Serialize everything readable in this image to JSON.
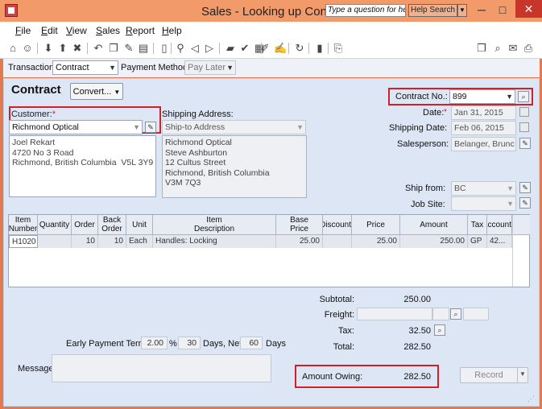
{
  "window": {
    "title": "Sales - Looking up Contract",
    "question_placeholder": "Type a question for help",
    "help_search": "Help Search",
    "min_glyph": "─",
    "max_glyph": "□",
    "close_glyph": "✕"
  },
  "menu": [
    "File",
    "Edit",
    "View",
    "Sales",
    "Report",
    "Help"
  ],
  "menu_underline": [
    "F",
    "E",
    "V",
    "S",
    "R",
    "H"
  ],
  "transaction": {
    "label": "Transaction:",
    "value": "Contract",
    "payment_label": "Payment Method:",
    "payment_value": "Pay Later"
  },
  "form": {
    "heading": "Contract",
    "convert_button": "Convert...",
    "customer_label": "Customer:",
    "required_mark": "*",
    "customer_value": "Richmond Optical",
    "customer_address": "Joel Rekart\n4720 No 3 Road\nRichmond, British Columbia  V5L 3Y9",
    "shipping_label": "Shipping Address:",
    "shipping_value": "Ship-to Address",
    "shipping_address": "Richmond Optical\nSteve Ashburton\n12 Cultus Street\nRichmond, British Columbia\nV3M 7Q3",
    "contract_no_label": "Contract No.:",
    "contract_no_value": "899",
    "date_label": "Date:",
    "date_value": "Jan 31, 2015",
    "shipping_date_label": "Shipping Date:",
    "shipping_date_value": "Feb 06, 2015",
    "salesperson_label": "Salesperson:",
    "salesperson_value": "Belanger, Brunc",
    "ship_from_label": "Ship from:",
    "ship_from_value": "BC",
    "job_site_label": "Job Site:",
    "job_site_value": ""
  },
  "grid": {
    "headers": [
      "Item\nNumber",
      "Quantity",
      "Order",
      "Back\nOrder",
      "Unit",
      "Item\nDescription",
      "Base\nPrice",
      "Discount",
      "Price",
      "Amount",
      "Tax",
      "Account"
    ],
    "rows": [
      [
        "H1020",
        "",
        "10",
        "10",
        "Each",
        "Handles: Locking",
        "25.00",
        "",
        "25.00",
        "250.00",
        "GP",
        "42..."
      ]
    ]
  },
  "totals": {
    "subtotal_label": "Subtotal:",
    "subtotal_value": "250.00",
    "freight_label": "Freight:",
    "tax_label": "Tax:",
    "tax_value": "32.50",
    "total_label": "Total:",
    "total_value": "282.50",
    "amount_owing_label": "Amount Owing:",
    "amount_owing_value": "282.50"
  },
  "terms": {
    "label": "Early Payment Terms:",
    "percent": "2.00",
    "percent_sign": "%",
    "days": "30",
    "days_net_label": "Days, Net",
    "net": "60",
    "days_label": "Days"
  },
  "message_label": "Message:",
  "record_button": "Record",
  "colors": {
    "highlight": "#d0202a",
    "panel": "#dde6f5",
    "titlebar": "#f39a6b",
    "close": "#c7362a"
  }
}
